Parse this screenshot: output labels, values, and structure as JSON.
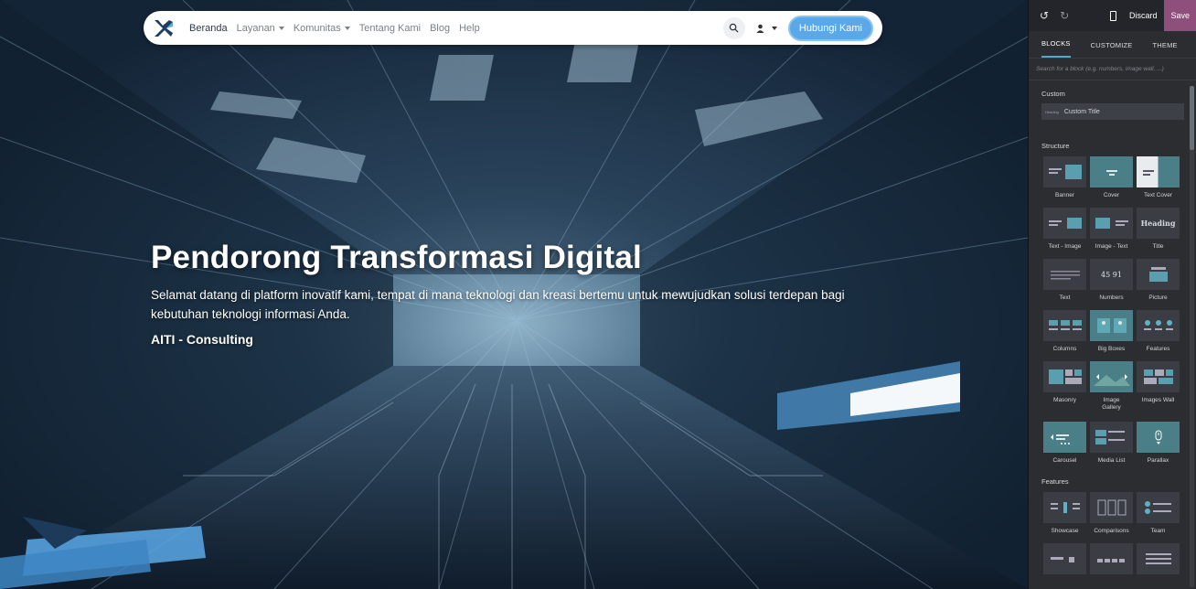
{
  "navbar": {
    "items": [
      {
        "label": "Beranda",
        "active": true,
        "dropdown": false
      },
      {
        "label": "Layanan",
        "active": false,
        "dropdown": true
      },
      {
        "label": "Komunitas",
        "active": false,
        "dropdown": true
      },
      {
        "label": "Tentang Kami",
        "active": false,
        "dropdown": false
      },
      {
        "label": "Blog",
        "active": false,
        "dropdown": false
      },
      {
        "label": "Help",
        "active": false,
        "dropdown": false
      }
    ],
    "cta_label": "Hubungi Kami",
    "icons": [
      "logo-icon",
      "search-icon",
      "user-icon"
    ]
  },
  "hero": {
    "title": "Pendorong Transformasi Digital",
    "subtitle": "Selamat datang di platform inovatif kami, tempat di mana teknologi dan kreasi bertemu untuk mewujudkan solusi terdepan bagi kebutuhan teknologi informasi Anda.",
    "tagline": "AITI - Consulting"
  },
  "editor": {
    "discard_label": "Discard",
    "save_label": "Save",
    "tabs": [
      "BLOCKS",
      "CUSTOMIZE",
      "THEME"
    ],
    "search_placeholder": "Search for a block (e.g. numbers, image wall, ...)",
    "sections": [
      {
        "title": "Custom",
        "items": [
          {
            "label": "Custom Title",
            "mini": "Heading"
          }
        ]
      },
      {
        "title": "Structure",
        "items": [
          {
            "label": "Banner"
          },
          {
            "label": "Cover"
          },
          {
            "label": "Text Cover"
          },
          {
            "label": "Text - Image"
          },
          {
            "label": "Image - Text"
          },
          {
            "label": "Title"
          },
          {
            "label": "Text"
          },
          {
            "label": "Numbers"
          },
          {
            "label": "Picture"
          },
          {
            "label": "Columns"
          },
          {
            "label": "Big Boxes"
          },
          {
            "label": "Features"
          },
          {
            "label": "Masonry"
          },
          {
            "label": "Image Gallery"
          },
          {
            "label": "Images Wall"
          },
          {
            "label": "Carousel"
          },
          {
            "label": "Media List"
          },
          {
            "label": "Parallax"
          }
        ]
      },
      {
        "title": "Features",
        "items": [
          {
            "label": "Showcase"
          },
          {
            "label": "Comparisons"
          },
          {
            "label": "Team"
          }
        ]
      }
    ],
    "thumb_text": {
      "title_thumb": "Heading",
      "numbers_thumb": "45 91"
    }
  },
  "colors": {
    "accent": "#5aa8e8",
    "save": "#8f4f7d",
    "tab_underline": "#55a6c7",
    "teal_thumb": "#4a7f87"
  }
}
